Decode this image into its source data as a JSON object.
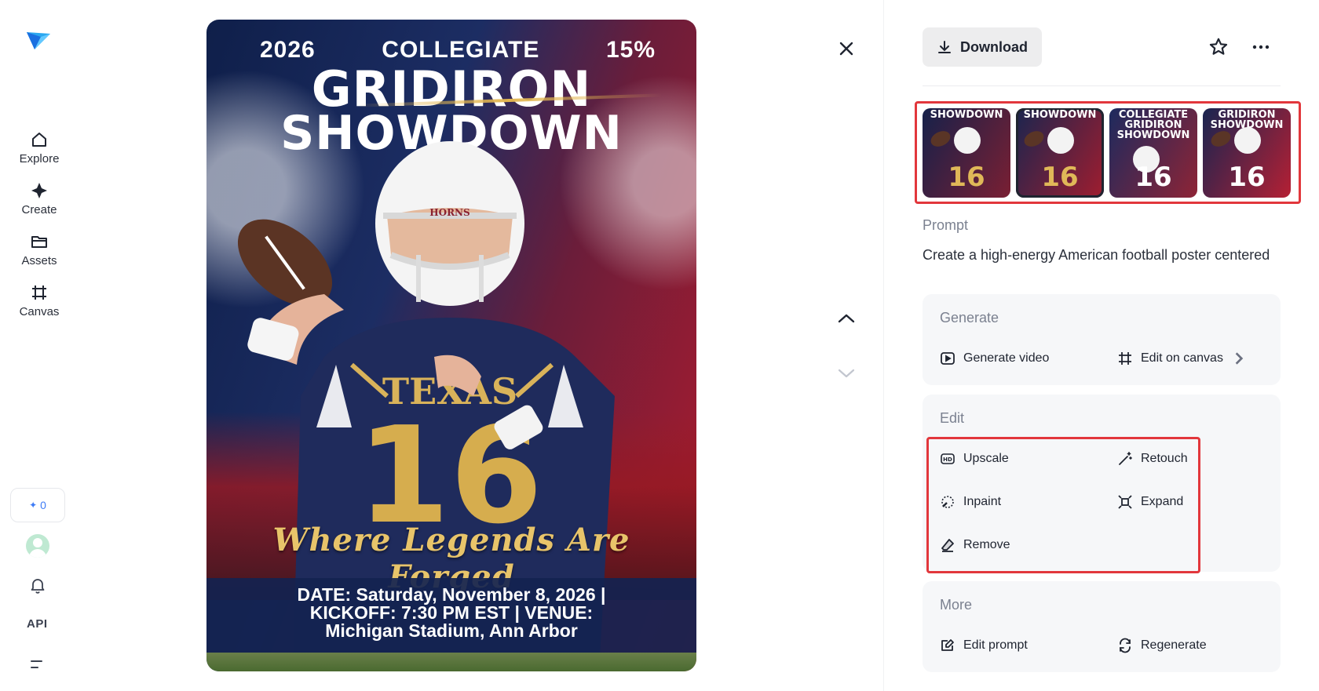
{
  "nav": {
    "items": [
      {
        "label": "Explore",
        "icon": "home-icon"
      },
      {
        "label": "Create",
        "icon": "sparkle-icon"
      },
      {
        "label": "Assets",
        "icon": "folder-icon"
      },
      {
        "label": "Canvas",
        "icon": "canvas-frame-icon"
      }
    ],
    "credits": "0",
    "api_label": "API"
  },
  "poster": {
    "year": "2026",
    "collegiate": "COLLEGIATE",
    "percent": "15%",
    "title_line1": "GRIDIRON",
    "title_line2": "SHOWDOWN",
    "helmet_text": "HORNS",
    "jersey_text": "TEXAS",
    "jersey_number": "16",
    "tagline": "Where Legends Are Forged",
    "info_line1": "DATE: Saturday, November 8, 2026 |",
    "info_line2": "KICKOFF: 7:30 PM EST | VENUE:",
    "info_line3": "Michigan Stadium, Ann Arbor"
  },
  "toolbar": {
    "download_label": "Download"
  },
  "thumbnails": [
    {
      "title": "SHOWDOWN",
      "number": "16",
      "selected": false
    },
    {
      "title": "SHOWDOWN",
      "number": "16",
      "selected": true
    },
    {
      "title": "COLLEGIATE GRIDIRON SHOWDOWN",
      "number": "16",
      "selected": false
    },
    {
      "title": "GRIDIRON SHOWDOWN",
      "number": "16",
      "selected": false
    }
  ],
  "prompt": {
    "label": "Prompt",
    "text": "Create a high-energy American football poster centered"
  },
  "generate": {
    "title": "Generate",
    "generate_video": "Generate video",
    "edit_on_canvas": "Edit on canvas"
  },
  "edit": {
    "title": "Edit",
    "upscale": "Upscale",
    "retouch": "Retouch",
    "inpaint": "Inpaint",
    "expand": "Expand",
    "remove": "Remove"
  },
  "more": {
    "title": "More",
    "edit_prompt": "Edit prompt",
    "regenerate": "Regenerate"
  },
  "colors": {
    "accent_highlight": "#e2373c",
    "brand_blue": "#3f7cf6",
    "card_bg": "#f6f7f9"
  }
}
